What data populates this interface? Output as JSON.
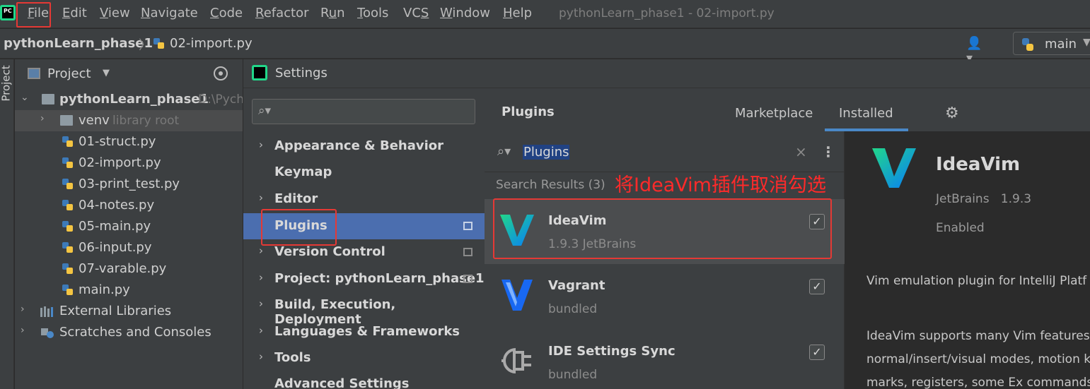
{
  "menubar": {
    "items": [
      {
        "label": "File",
        "underline": "F"
      },
      {
        "label": "Edit",
        "underline": "E"
      },
      {
        "label": "View",
        "underline": "V"
      },
      {
        "label": "Navigate",
        "underline": "N"
      },
      {
        "label": "Code",
        "underline": "C"
      },
      {
        "label": "Refactor",
        "underline": "R"
      },
      {
        "label": "Run",
        "underline": "u"
      },
      {
        "label": "Tools",
        "underline": "T"
      },
      {
        "label": "VCS",
        "underline": "S"
      },
      {
        "label": "Window",
        "underline": "W"
      },
      {
        "label": "Help",
        "underline": "H"
      }
    ],
    "window_title": "pythonLearn_phase1 - 02-import.py",
    "app_logo_text": "PC"
  },
  "navbar": {
    "project": "pythonLearn_phase1",
    "file": "02-import.py",
    "run_config": "main"
  },
  "toolstrip": {
    "label": "Project"
  },
  "project_panel": {
    "title": "Project",
    "root": {
      "name": "pythonLearn_phase1",
      "path": "D:\\Pych"
    },
    "venv": {
      "name": "venv",
      "hint": "library root"
    },
    "files": [
      "01-struct.py",
      "02-import.py",
      "03-print_test.py",
      "04-notes.py",
      "05-main.py",
      "06-input.py",
      "07-varable.py",
      "main.py"
    ],
    "external_libraries": "External Libraries",
    "scratches": "Scratches and Consoles"
  },
  "settings": {
    "title": "Settings",
    "search_placeholder": "",
    "nav": [
      {
        "label": "Appearance & Behavior",
        "arrow": true,
        "badge": false
      },
      {
        "label": "Keymap",
        "arrow": false,
        "badge": false
      },
      {
        "label": "Editor",
        "arrow": true,
        "badge": false
      },
      {
        "label": "Plugins",
        "arrow": false,
        "badge": true,
        "selected": true
      },
      {
        "label": "Version Control",
        "arrow": true,
        "badge": true
      },
      {
        "label": "Project: pythonLearn_phase1",
        "arrow": true,
        "badge": true
      },
      {
        "label": "Build, Execution, Deployment",
        "arrow": true,
        "badge": false
      },
      {
        "label": "Languages & Frameworks",
        "arrow": true,
        "badge": false
      },
      {
        "label": "Tools",
        "arrow": true,
        "badge": false
      },
      {
        "label": "Advanced Settings",
        "arrow": false,
        "badge": false
      }
    ]
  },
  "plugins": {
    "title": "Plugins",
    "tabs": [
      "Marketplace",
      "Installed"
    ],
    "active_tab": "Installed",
    "search_query": "Plugins",
    "results_label": "Search Results (3)",
    "annotation": "将IdeaVim插件取消勾选",
    "list": [
      {
        "name": "IdeaVim",
        "meta": "1.9.3  JetBrains",
        "checked": true
      },
      {
        "name": "Vagrant",
        "meta": "bundled",
        "checked": true
      },
      {
        "name": "IDE Settings Sync",
        "meta": "bundled",
        "checked": true
      }
    ],
    "detail": {
      "name": "IdeaVim",
      "vendor": "JetBrains",
      "version": "1.9.3",
      "status": "Enabled",
      "desc1": "Vim emulation plugin for IntelliJ Platf",
      "desc2": "IdeaVim supports many Vim features",
      "desc3": "normal/insert/visual modes, motion k",
      "desc4": "marks, registers, some Ex commands,"
    }
  },
  "colors": {
    "accent": "#4b6eaf",
    "highlight": "#e53935",
    "annotation": "#ff2a2a",
    "ideavim_green": "#21d789",
    "ideavim_blue": "#087cfa"
  }
}
